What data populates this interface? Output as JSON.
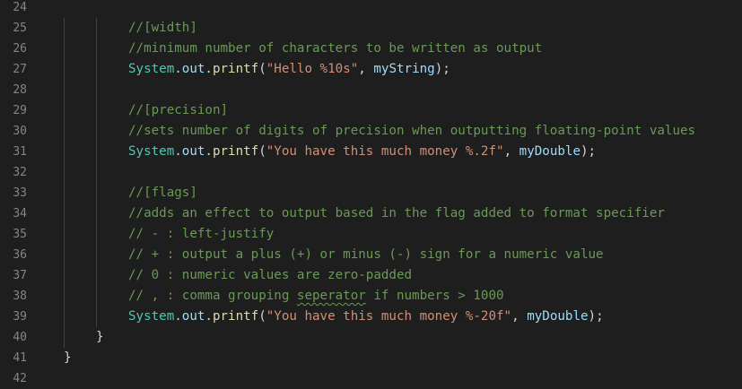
{
  "editor": {
    "lines": [
      {
        "num": "24",
        "indent": 0,
        "tokens": []
      },
      {
        "num": "25",
        "indent": 2,
        "tokens": [
          {
            "t": "comment",
            "v": "//[width]"
          }
        ]
      },
      {
        "num": "26",
        "indent": 2,
        "tokens": [
          {
            "t": "comment",
            "v": "//minimum number of characters to be written as output"
          }
        ]
      },
      {
        "num": "27",
        "indent": 2,
        "tokens": [
          {
            "t": "class",
            "v": "System"
          },
          {
            "t": "punct",
            "v": "."
          },
          {
            "t": "var",
            "v": "out"
          },
          {
            "t": "punct",
            "v": "."
          },
          {
            "t": "fn",
            "v": "printf"
          },
          {
            "t": "punct",
            "v": "("
          },
          {
            "t": "str",
            "v": "\"Hello %10s\""
          },
          {
            "t": "punct",
            "v": ", "
          },
          {
            "t": "var",
            "v": "myString"
          },
          {
            "t": "punct",
            "v": ");"
          }
        ]
      },
      {
        "num": "28",
        "indent": 2,
        "tokens": []
      },
      {
        "num": "29",
        "indent": 2,
        "tokens": [
          {
            "t": "comment",
            "v": "//[precision]"
          }
        ]
      },
      {
        "num": "30",
        "indent": 2,
        "tokens": [
          {
            "t": "comment",
            "v": "//sets number of digits of precision when outputting floating-point values"
          }
        ]
      },
      {
        "num": "31",
        "indent": 2,
        "tokens": [
          {
            "t": "class",
            "v": "System"
          },
          {
            "t": "punct",
            "v": "."
          },
          {
            "t": "var",
            "v": "out"
          },
          {
            "t": "punct",
            "v": "."
          },
          {
            "t": "fn",
            "v": "printf"
          },
          {
            "t": "punct",
            "v": "("
          },
          {
            "t": "str",
            "v": "\"You have this much money %.2f\""
          },
          {
            "t": "punct",
            "v": ", "
          },
          {
            "t": "var",
            "v": "myDouble"
          },
          {
            "t": "punct",
            "v": ");"
          }
        ]
      },
      {
        "num": "32",
        "indent": 2,
        "tokens": []
      },
      {
        "num": "33",
        "indent": 2,
        "tokens": [
          {
            "t": "comment",
            "v": "//[flags]"
          }
        ]
      },
      {
        "num": "34",
        "indent": 2,
        "tokens": [
          {
            "t": "comment",
            "v": "//adds an effect to output based in the flag added to format specifier"
          }
        ]
      },
      {
        "num": "35",
        "indent": 2,
        "tokens": [
          {
            "t": "comment",
            "v": "// - : left-justify"
          }
        ]
      },
      {
        "num": "36",
        "indent": 2,
        "tokens": [
          {
            "t": "comment",
            "v": "// + : output a plus (+) or minus (-) sign for a numeric value"
          }
        ]
      },
      {
        "num": "37",
        "indent": 2,
        "tokens": [
          {
            "t": "comment",
            "v": "// 0 : numeric values are zero-padded"
          }
        ]
      },
      {
        "num": "38",
        "indent": 2,
        "tokens": [
          {
            "t": "comment",
            "v": "// , : comma grouping "
          },
          {
            "t": "comment",
            "v": "seperator",
            "squiggle": true
          },
          {
            "t": "comment",
            "v": " if numbers > 1000"
          }
        ]
      },
      {
        "num": "39",
        "indent": 2,
        "tokens": [
          {
            "t": "class",
            "v": "System"
          },
          {
            "t": "punct",
            "v": "."
          },
          {
            "t": "var",
            "v": "out"
          },
          {
            "t": "punct",
            "v": "."
          },
          {
            "t": "fn",
            "v": "printf"
          },
          {
            "t": "punct",
            "v": "("
          },
          {
            "t": "str",
            "v": "\"You have this much money %-20f\""
          },
          {
            "t": "punct",
            "v": ", "
          },
          {
            "t": "var",
            "v": "myDouble"
          },
          {
            "t": "punct",
            "v": ");"
          }
        ]
      },
      {
        "num": "40",
        "indent": 1,
        "tokens": [
          {
            "t": "punct",
            "v": "}"
          }
        ]
      },
      {
        "num": "41",
        "indent": 0,
        "tokens": [
          {
            "t": "punct",
            "v": "}"
          }
        ]
      },
      {
        "num": "42",
        "indent": 0,
        "tokens": []
      }
    ]
  }
}
